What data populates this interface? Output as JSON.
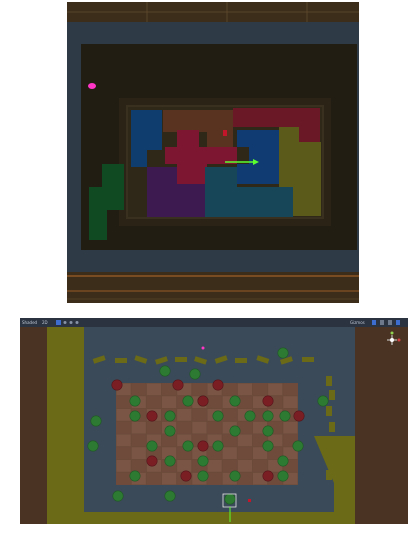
{
  "top_scene": {
    "view": "scene-top-down",
    "pieces": [
      {
        "name": "blue-piece",
        "color": "#0f3d6e"
      },
      {
        "name": "brown-piece",
        "color": "#5a3320"
      },
      {
        "name": "red-cross-piece",
        "color": "#7d1631"
      },
      {
        "name": "dark-red-piece",
        "color": "#6a1726"
      },
      {
        "name": "olive-piece",
        "color": "#5b5a1b"
      },
      {
        "name": "teal-piece",
        "color": "#164657"
      },
      {
        "name": "purple-piece",
        "color": "#3d1a4f"
      },
      {
        "name": "green-piece",
        "color": "#0f4a22"
      }
    ],
    "marker_color": "#ff35c8",
    "gizmo_color": "#5cff2e"
  },
  "bottom_scene": {
    "toolbar": {
      "left_labels": [
        "Shaded",
        "2D"
      ],
      "right_labels": [
        "Gizmos"
      ]
    },
    "board": {
      "rows": 8,
      "cols": 12
    },
    "token_colors": {
      "green": "#2d7a32",
      "red": "#7a1e24"
    },
    "panel_color": "#6b6a17"
  }
}
